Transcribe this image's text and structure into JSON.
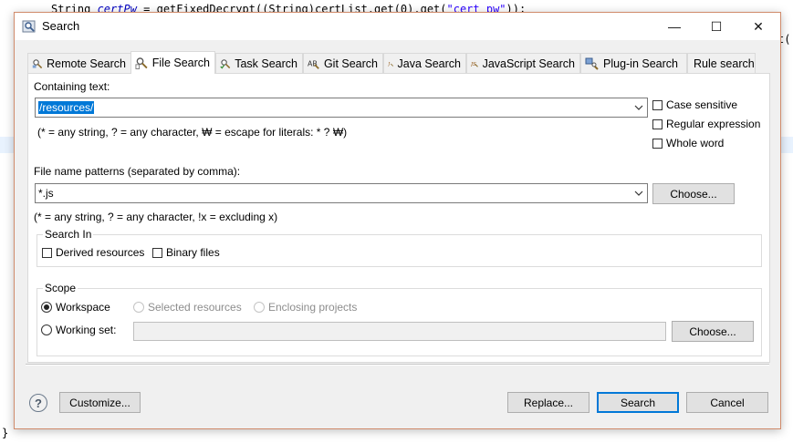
{
  "background": {
    "code_prefix": "String ",
    "code_var": "certPw",
    "code_mid": " = getFixedDecrypt((String)certList.get(0).get(",
    "code_str": "\"cert_pw\"",
    "code_end": "));",
    "right_fragment": "t(",
    "closing_brace": "}"
  },
  "window": {
    "title": "Search",
    "minimize": "—",
    "maximize": "☐",
    "close": "✕"
  },
  "tabs": [
    {
      "label": "Remote Search",
      "icon": "remote-search-icon",
      "active": false
    },
    {
      "label": "File Search",
      "icon": "file-search-icon",
      "active": true
    },
    {
      "label": "Task Search",
      "icon": "task-search-icon",
      "active": false
    },
    {
      "label": "Git Search",
      "icon": "git-search-icon",
      "active": false
    },
    {
      "label": "Java Search",
      "icon": "java-search-icon",
      "active": false
    },
    {
      "label": "JavaScript Search",
      "icon": "javascript-search-icon",
      "active": false
    },
    {
      "label": "Plug-in Search",
      "icon": "plugin-search-icon",
      "active": false
    },
    {
      "label": "Rule search",
      "icon": "",
      "active": false
    }
  ],
  "containing": {
    "label": "Containing text:",
    "value": "/resources/",
    "hint": "(* = any string, ? = any character, ₩ = escape for literals: * ? ₩)",
    "case_sensitive": "Case sensitive",
    "regular_expression": "Regular expression",
    "whole_word": "Whole word"
  },
  "patterns": {
    "label": "File name patterns (separated by comma):",
    "value": "*.js",
    "choose": "Choose...",
    "hint": "(* = any string, ? = any character, !x = excluding x)"
  },
  "search_in": {
    "title": "Search In",
    "derived": "Derived resources",
    "binary": "Binary files"
  },
  "scope": {
    "title": "Scope",
    "workspace": "Workspace",
    "selected_resources": "Selected resources",
    "enclosing_projects": "Enclosing projects",
    "working_set": "Working set:",
    "working_set_value": "",
    "choose": "Choose..."
  },
  "footer": {
    "help": "?",
    "customize": "Customize...",
    "replace": "Replace...",
    "search": "Search",
    "cancel": "Cancel"
  },
  "colors": {
    "accent": "#0078d7",
    "dialog_border": "#d08b6b"
  }
}
